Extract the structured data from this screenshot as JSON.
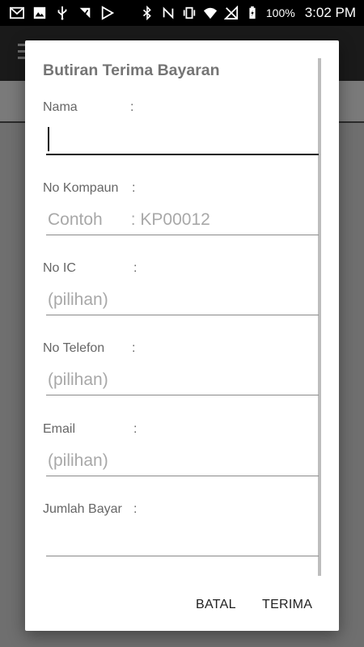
{
  "status_bar": {
    "icons_left": [
      "gmail-icon",
      "image-icon",
      "usb-icon",
      "download-icon",
      "play-store-icon"
    ],
    "icons_right": [
      "bluetooth-icon",
      "nfc-icon",
      "vibrate-icon",
      "wifi-icon",
      "no-signal-icon",
      "battery-icon"
    ],
    "battery": "100%",
    "time": "3:02 PM"
  },
  "dialog": {
    "title": "Butiran Terima Bayaran",
    "fields": [
      {
        "label": "Nama",
        "colon": ":",
        "value": "",
        "placeholder": ""
      },
      {
        "label": "No Kompaun",
        "colon": ":",
        "value": "",
        "placeholder": "Contoh      : KP00012"
      },
      {
        "label": "No IC",
        "colon": ":",
        "value": "",
        "placeholder": "(pilihan)"
      },
      {
        "label": "No Telefon",
        "colon": ":",
        "value": "",
        "placeholder": "(pilihan)"
      },
      {
        "label": "Email",
        "colon": ":",
        "value": "",
        "placeholder": "(pilihan)"
      },
      {
        "label": "Jumlah Bayar",
        "colon": ":",
        "value": "",
        "placeholder": ""
      }
    ],
    "cancel_label": "BATAL",
    "ok_label": "TERIMA"
  },
  "colors": {
    "title": "#757575",
    "placeholder": "#a8a8a8",
    "scrim": "#6f6f6f",
    "status_bar": "#000000"
  }
}
